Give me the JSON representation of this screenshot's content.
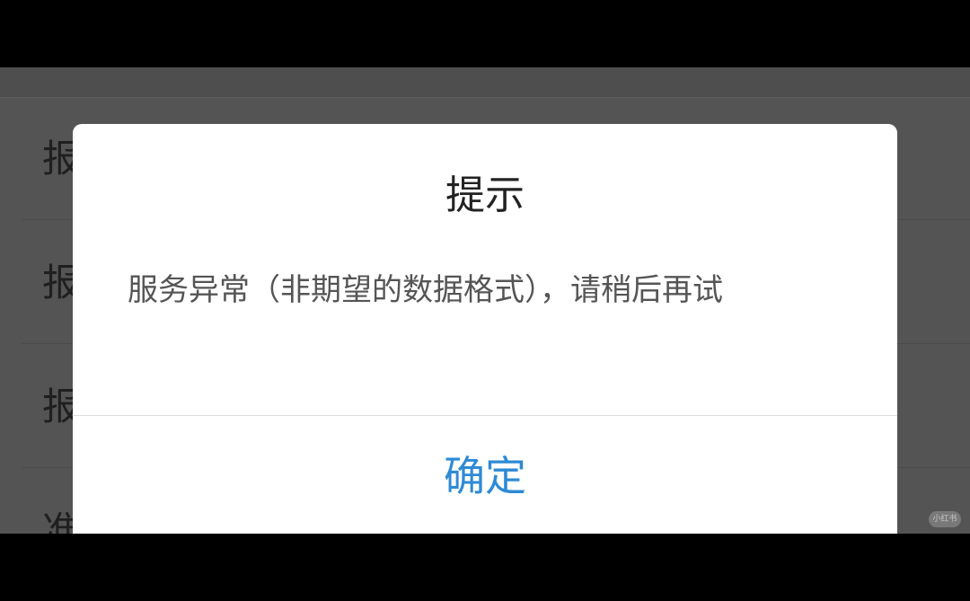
{
  "background_list": {
    "items": [
      {
        "label": "报"
      },
      {
        "label": "报"
      },
      {
        "label": "报"
      },
      {
        "label": "准"
      }
    ]
  },
  "dialog": {
    "title": "提示",
    "message": "服务异常（非期望的数据格式），请稍后再试",
    "confirm_label": "确定"
  },
  "watermark": {
    "text": "小红书"
  },
  "colors": {
    "accent": "#2e8ad6",
    "overlay": "#545454",
    "dialog_bg": "#ffffff"
  }
}
